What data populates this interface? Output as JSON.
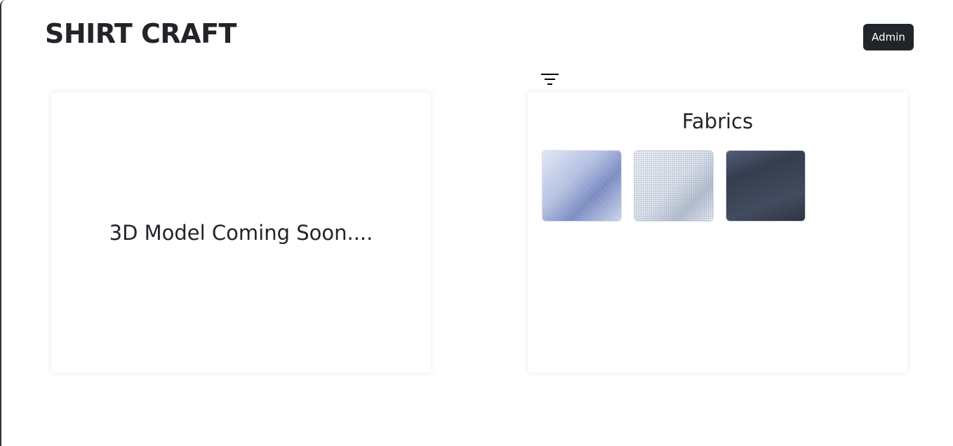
{
  "header": {
    "title": "SHIRT CRAFT",
    "admin_label": "Admin"
  },
  "toolbar": {
    "filter_icon": "filter-icon"
  },
  "model_panel": {
    "message": "3D Model Coming Soon...."
  },
  "fabrics_panel": {
    "title": "Fabrics",
    "swatches": [
      {
        "color": "#aebbe0"
      },
      {
        "color": "#e1e6ee"
      },
      {
        "color": "#2b3344"
      }
    ]
  }
}
